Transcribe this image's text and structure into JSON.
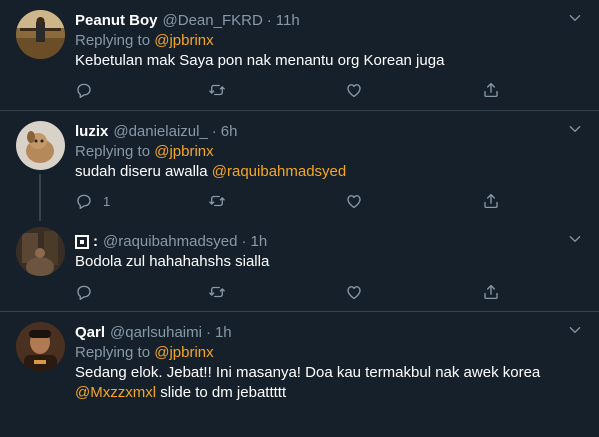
{
  "tweets": [
    {
      "name": "Peanut Boy",
      "handle": "@Dean_FKRD",
      "time": "11h",
      "replying_label": "Replying to",
      "replying_to": "@jpbrinx",
      "text": "Kebetulan mak Saya pon nak menantu org Korean juga",
      "reply_count": ""
    },
    {
      "name": "luzix",
      "handle": "@danielaizul_",
      "time": "6h",
      "replying_label": "Replying to",
      "replying_to": "@jpbrinx",
      "text": "sudah diseru awalla",
      "text_mention": "@raquibahmadsyed",
      "reply_count": "1"
    },
    {
      "name": ":",
      "handle": "@raquibahmadsyed",
      "time": "1h",
      "text": "Bodola zul hahahahshs sialla",
      "reply_count": ""
    },
    {
      "name": "Qarl",
      "handle": "@qarlsuhaimi",
      "time": "1h",
      "replying_label": "Replying to",
      "replying_to": "@jpbrinx",
      "text_line1": "Sedang elok. Jebat!! Ini masanya! Doa kau termakbul nak awek korea",
      "text_mention": "@Mxzzxmxl",
      "text_line2": "slide to dm jebattttt"
    }
  ],
  "icons": {
    "reply": "reply-icon",
    "retweet": "retweet-icon",
    "like": "heart-icon",
    "share": "share-icon",
    "more": "chevron-down-icon"
  },
  "colors": {
    "background": "#15202b",
    "divider": "#38444d",
    "secondary_text": "#8899a6",
    "mention": "#f5a623"
  }
}
